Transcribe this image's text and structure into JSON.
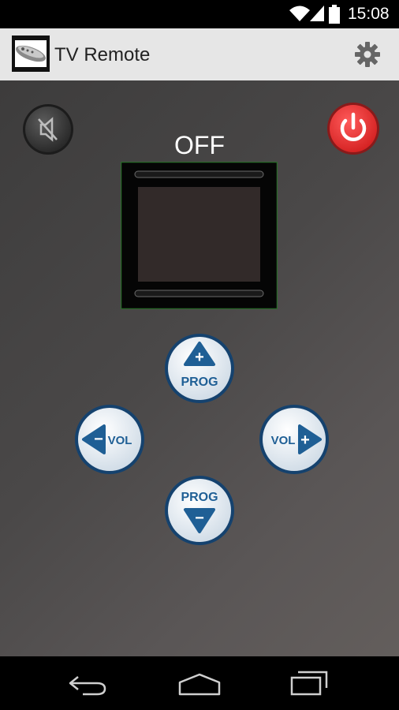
{
  "status_bar": {
    "time": "15:08",
    "icons": [
      "wifi-icon",
      "signal-icon",
      "battery-icon"
    ]
  },
  "action_bar": {
    "title": "TV Remote",
    "app_icon": "remote-control-icon",
    "settings_icon": "gear-icon"
  },
  "remote": {
    "tv_state": "OFF",
    "mute_icon": "mute-icon",
    "power_icon": "power-icon",
    "buttons": {
      "prog_up": {
        "symbol": "+",
        "label": "PROG"
      },
      "prog_down": {
        "symbol": "−",
        "label": "PROG"
      },
      "vol_down": {
        "symbol": "−",
        "label": "VOL"
      },
      "vol_up": {
        "symbol": "+",
        "label": "VOL"
      }
    }
  },
  "nav_bar": {
    "icons": [
      "back-icon",
      "home-icon",
      "recents-icon"
    ]
  },
  "colors": {
    "action_bar_bg": "#e6e6e6",
    "power_red": "#e53935",
    "button_blue": "#1f5f95",
    "tv_screen": "#322a29"
  }
}
